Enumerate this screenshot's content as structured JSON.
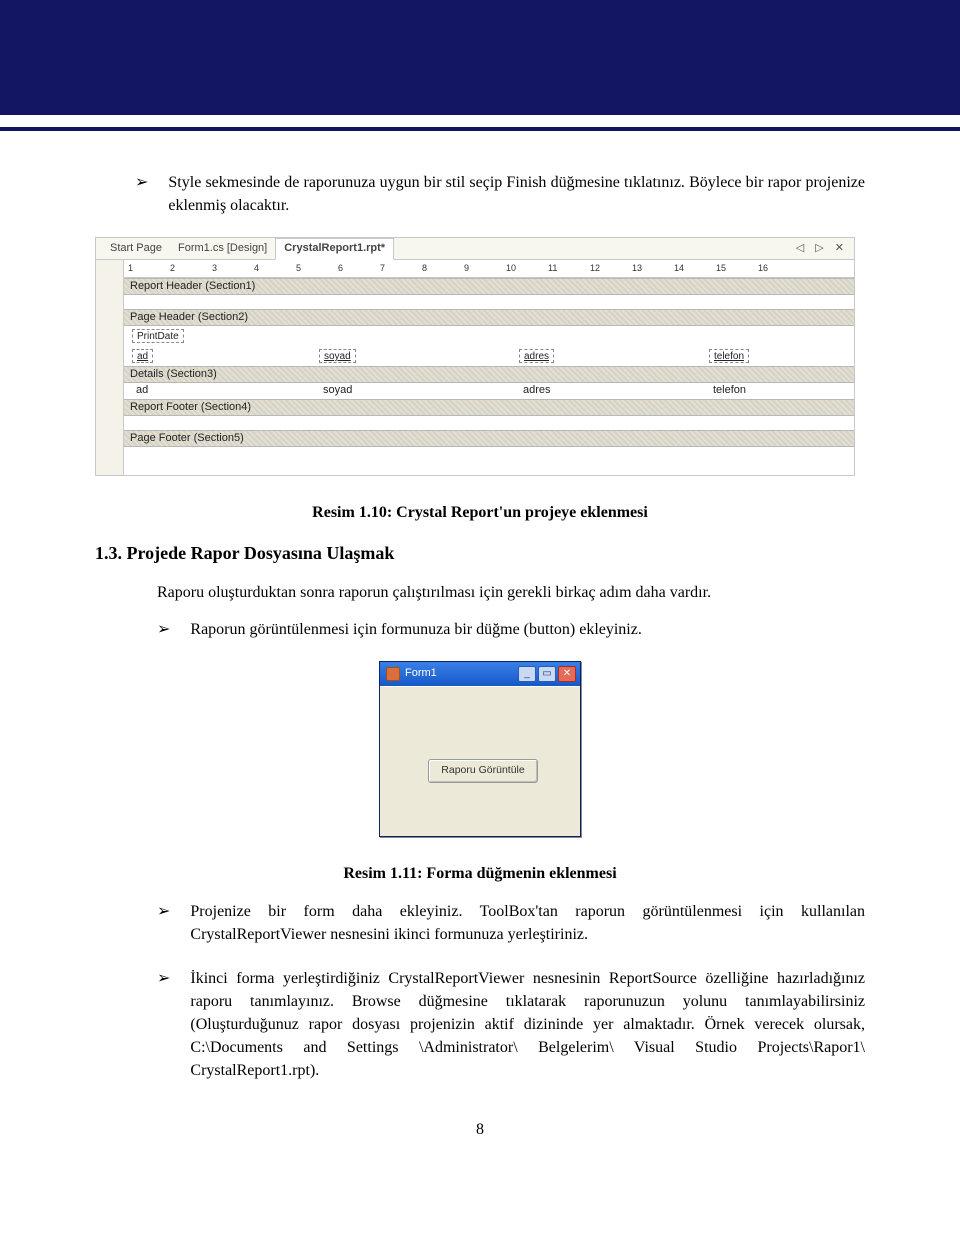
{
  "intro_bullet": "Style sekmesinde de raporunuza uygun bir stil seçip Finish düğmesine tıklatınız. Böylece bir rapor projenize eklenmiş olacaktır.",
  "caption1": "Resim 1.10: Crystal Report'un projeye eklenmesi",
  "heading": "1.3. Projede Rapor Dosyasına Ulaşmak",
  "para1": "Raporu oluşturduktan sonra raporun çalıştırılması için gerekli birkaç adım daha vardır.",
  "bullet2": "Raporun görüntülenmesi için formunuza bir düğme (button) ekleyiniz.",
  "caption2": "Resim 1.11: Forma düğmenin eklenmesi",
  "bullet3": "Projenize bir form daha ekleyiniz. ToolBox'tan raporun görüntülenmesi için kullanılan CrystalReportViewer nesnesini ikinci formunuza yerleştiriniz.",
  "bullet4": "İkinci forma yerleştirdiğiniz CrystalReportViewer nesnesinin ReportSource özelliğine hazırladığınız raporu tanımlayınız. Browse düğmesine tıklatarak raporunuzun yolunu tanımlayabilirsiniz (Oluşturduğunuz rapor dosyası projenizin aktif dizininde yer almaktadır. Örnek verecek olursak, C:\\Documents and Settings \\Administrator\\ Belgelerim\\ Visual Studio Projects\\Rapor1\\ CrystalReport1.rpt).",
  "page_number": "8",
  "shot1": {
    "tabs": {
      "start": "Start Page",
      "design": "Form1.cs [Design]",
      "active": "CrystalReport1.rpt*"
    },
    "nav_right": "◁ ▷ ✕",
    "ruler_marks": [
      "1",
      "2",
      "3",
      "4",
      "5",
      "6",
      "7",
      "8",
      "9",
      "10",
      "11",
      "12",
      "13",
      "14",
      "15",
      "16"
    ],
    "sections": {
      "report_header": "Report Header (Section1)",
      "page_header": "Page Header (Section2)",
      "details": "Details (Section3)",
      "report_footer": "Report Footer (Section4)",
      "page_footer": "Page Footer (Section5)"
    },
    "fields": {
      "printdate": "PrintDate",
      "ad": "ad",
      "soyad": "soyad",
      "adres": "adres",
      "telefon": "telefon"
    }
  },
  "shot2": {
    "title": "Form1",
    "min": "_",
    "max": "▭",
    "close": "✕",
    "button_label": "Raporu Görüntüle"
  }
}
